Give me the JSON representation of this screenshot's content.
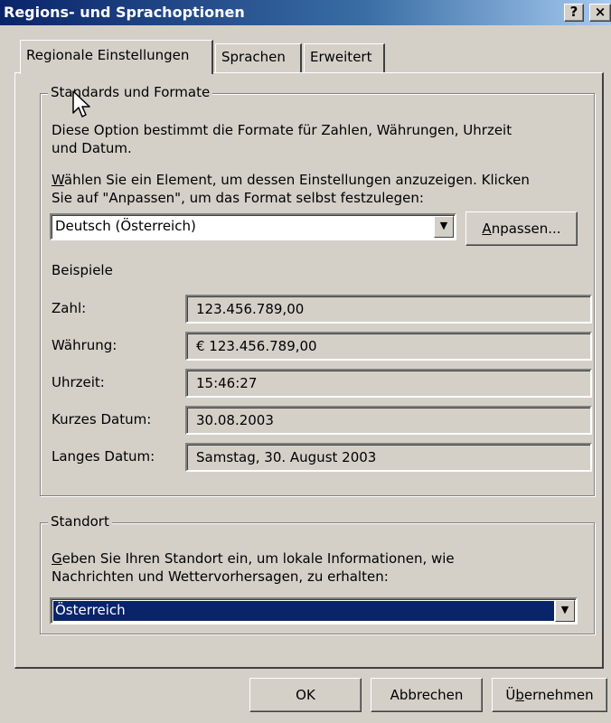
{
  "window": {
    "title": "Regions- und Sprachoptionen",
    "help_glyph": "?",
    "close_glyph": "×"
  },
  "tabs": [
    {
      "label": "Regionale Einstellungen",
      "active": true
    },
    {
      "label": "Sprachen",
      "active": false
    },
    {
      "label": "Erweitert",
      "active": false
    }
  ],
  "standards": {
    "group_label": "Standards und Formate",
    "description_line1": "Diese Option bestimmt die Formate für Zahlen, Währungen, Uhrzeit",
    "description_line2": "und Datum.",
    "instruction_line1_accel": "W",
    "instruction_line1_rest": "ählen Sie ein Element, um dessen Einstellungen anzuzeigen. Klicken",
    "instruction_line2": "Sie auf \"Anpassen\", um das Format selbst festzulegen:",
    "locale_value": "Deutsch (Österreich)",
    "customize_accel": "A",
    "customize_rest": "npassen...",
    "examples_label": "Beispiele",
    "examples": [
      {
        "label": "Zahl:",
        "value": "123.456.789,00"
      },
      {
        "label": "Währung:",
        "value": "€ 123.456.789,00"
      },
      {
        "label": "Uhrzeit:",
        "value": "15:46:27"
      },
      {
        "label": "Kurzes Datum:",
        "value": "30.08.2003"
      },
      {
        "label": "Langes Datum:",
        "value": "Samstag, 30. August 2003"
      }
    ]
  },
  "location": {
    "group_label": "Standort",
    "description_line1_accel": "G",
    "description_line1_rest": "eben Sie Ihren Standort ein, um lokale Informationen, wie",
    "description_line2": "Nachrichten und Wettervorhersagen, zu erhalten:",
    "value": "Österreich",
    "highlight_color": "#0a246a"
  },
  "buttons": {
    "ok": "OK",
    "cancel": "Abbrechen",
    "apply_pre": "Ü",
    "apply_accel": "b",
    "apply_rest": "ernehmen"
  },
  "icons": {
    "dropdown": "▼"
  }
}
